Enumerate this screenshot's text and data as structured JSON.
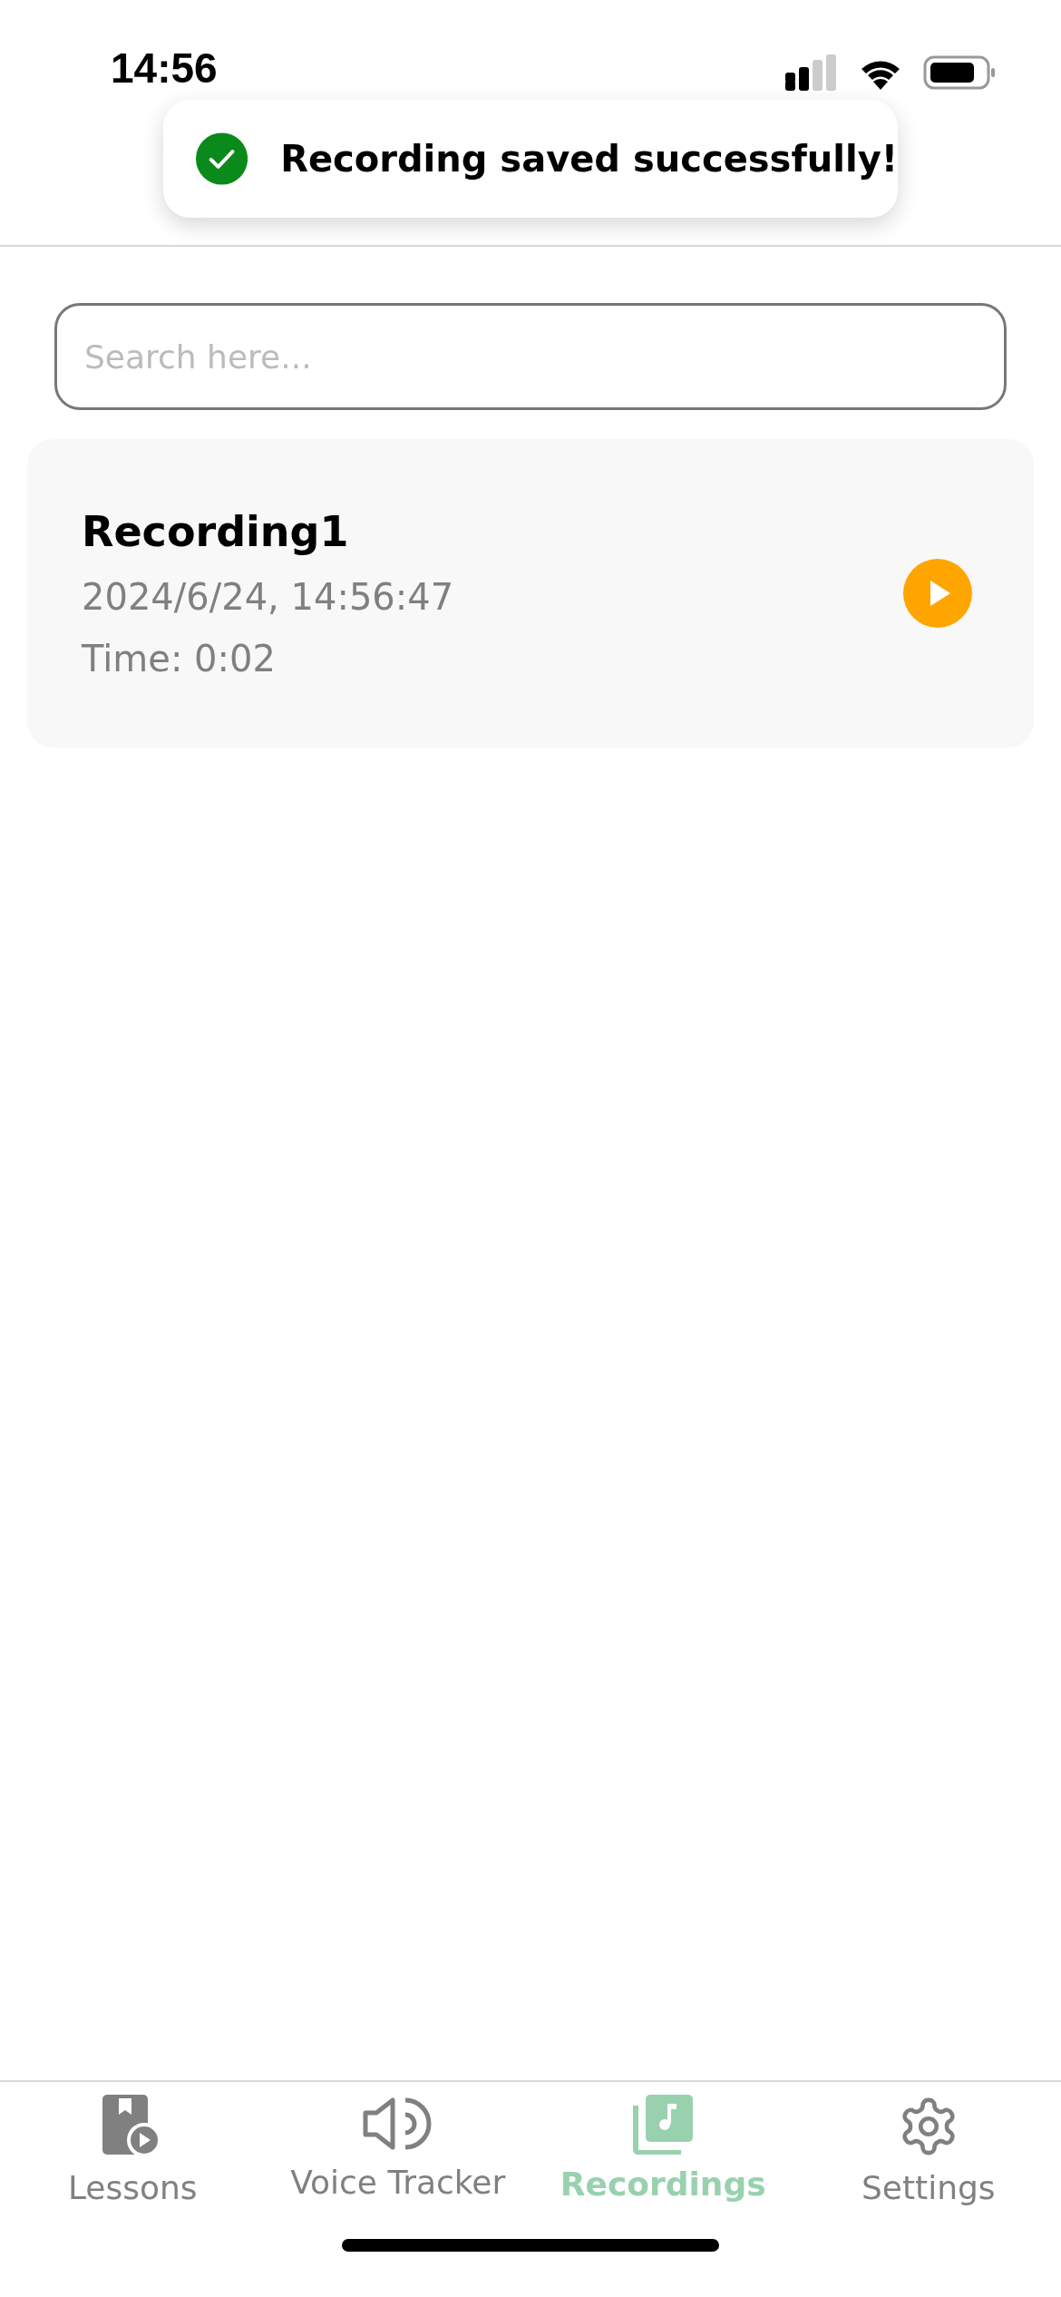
{
  "status_bar": {
    "time": "14:56"
  },
  "toast": {
    "message": "Recording saved successfully!"
  },
  "search": {
    "placeholder": "Search here..."
  },
  "recordings": [
    {
      "title": "Recording1",
      "date": "2024/6/24, 14:56:47",
      "duration": "Time: 0:02"
    }
  ],
  "tabs": [
    {
      "label": "Lessons",
      "kind": "lessons",
      "selected": false
    },
    {
      "label": "Voice Tracker",
      "kind": "voice",
      "selected": false
    },
    {
      "label": "Recordings",
      "kind": "recordings",
      "selected": true
    },
    {
      "label": "Settings",
      "kind": "settings",
      "selected": false
    }
  ]
}
